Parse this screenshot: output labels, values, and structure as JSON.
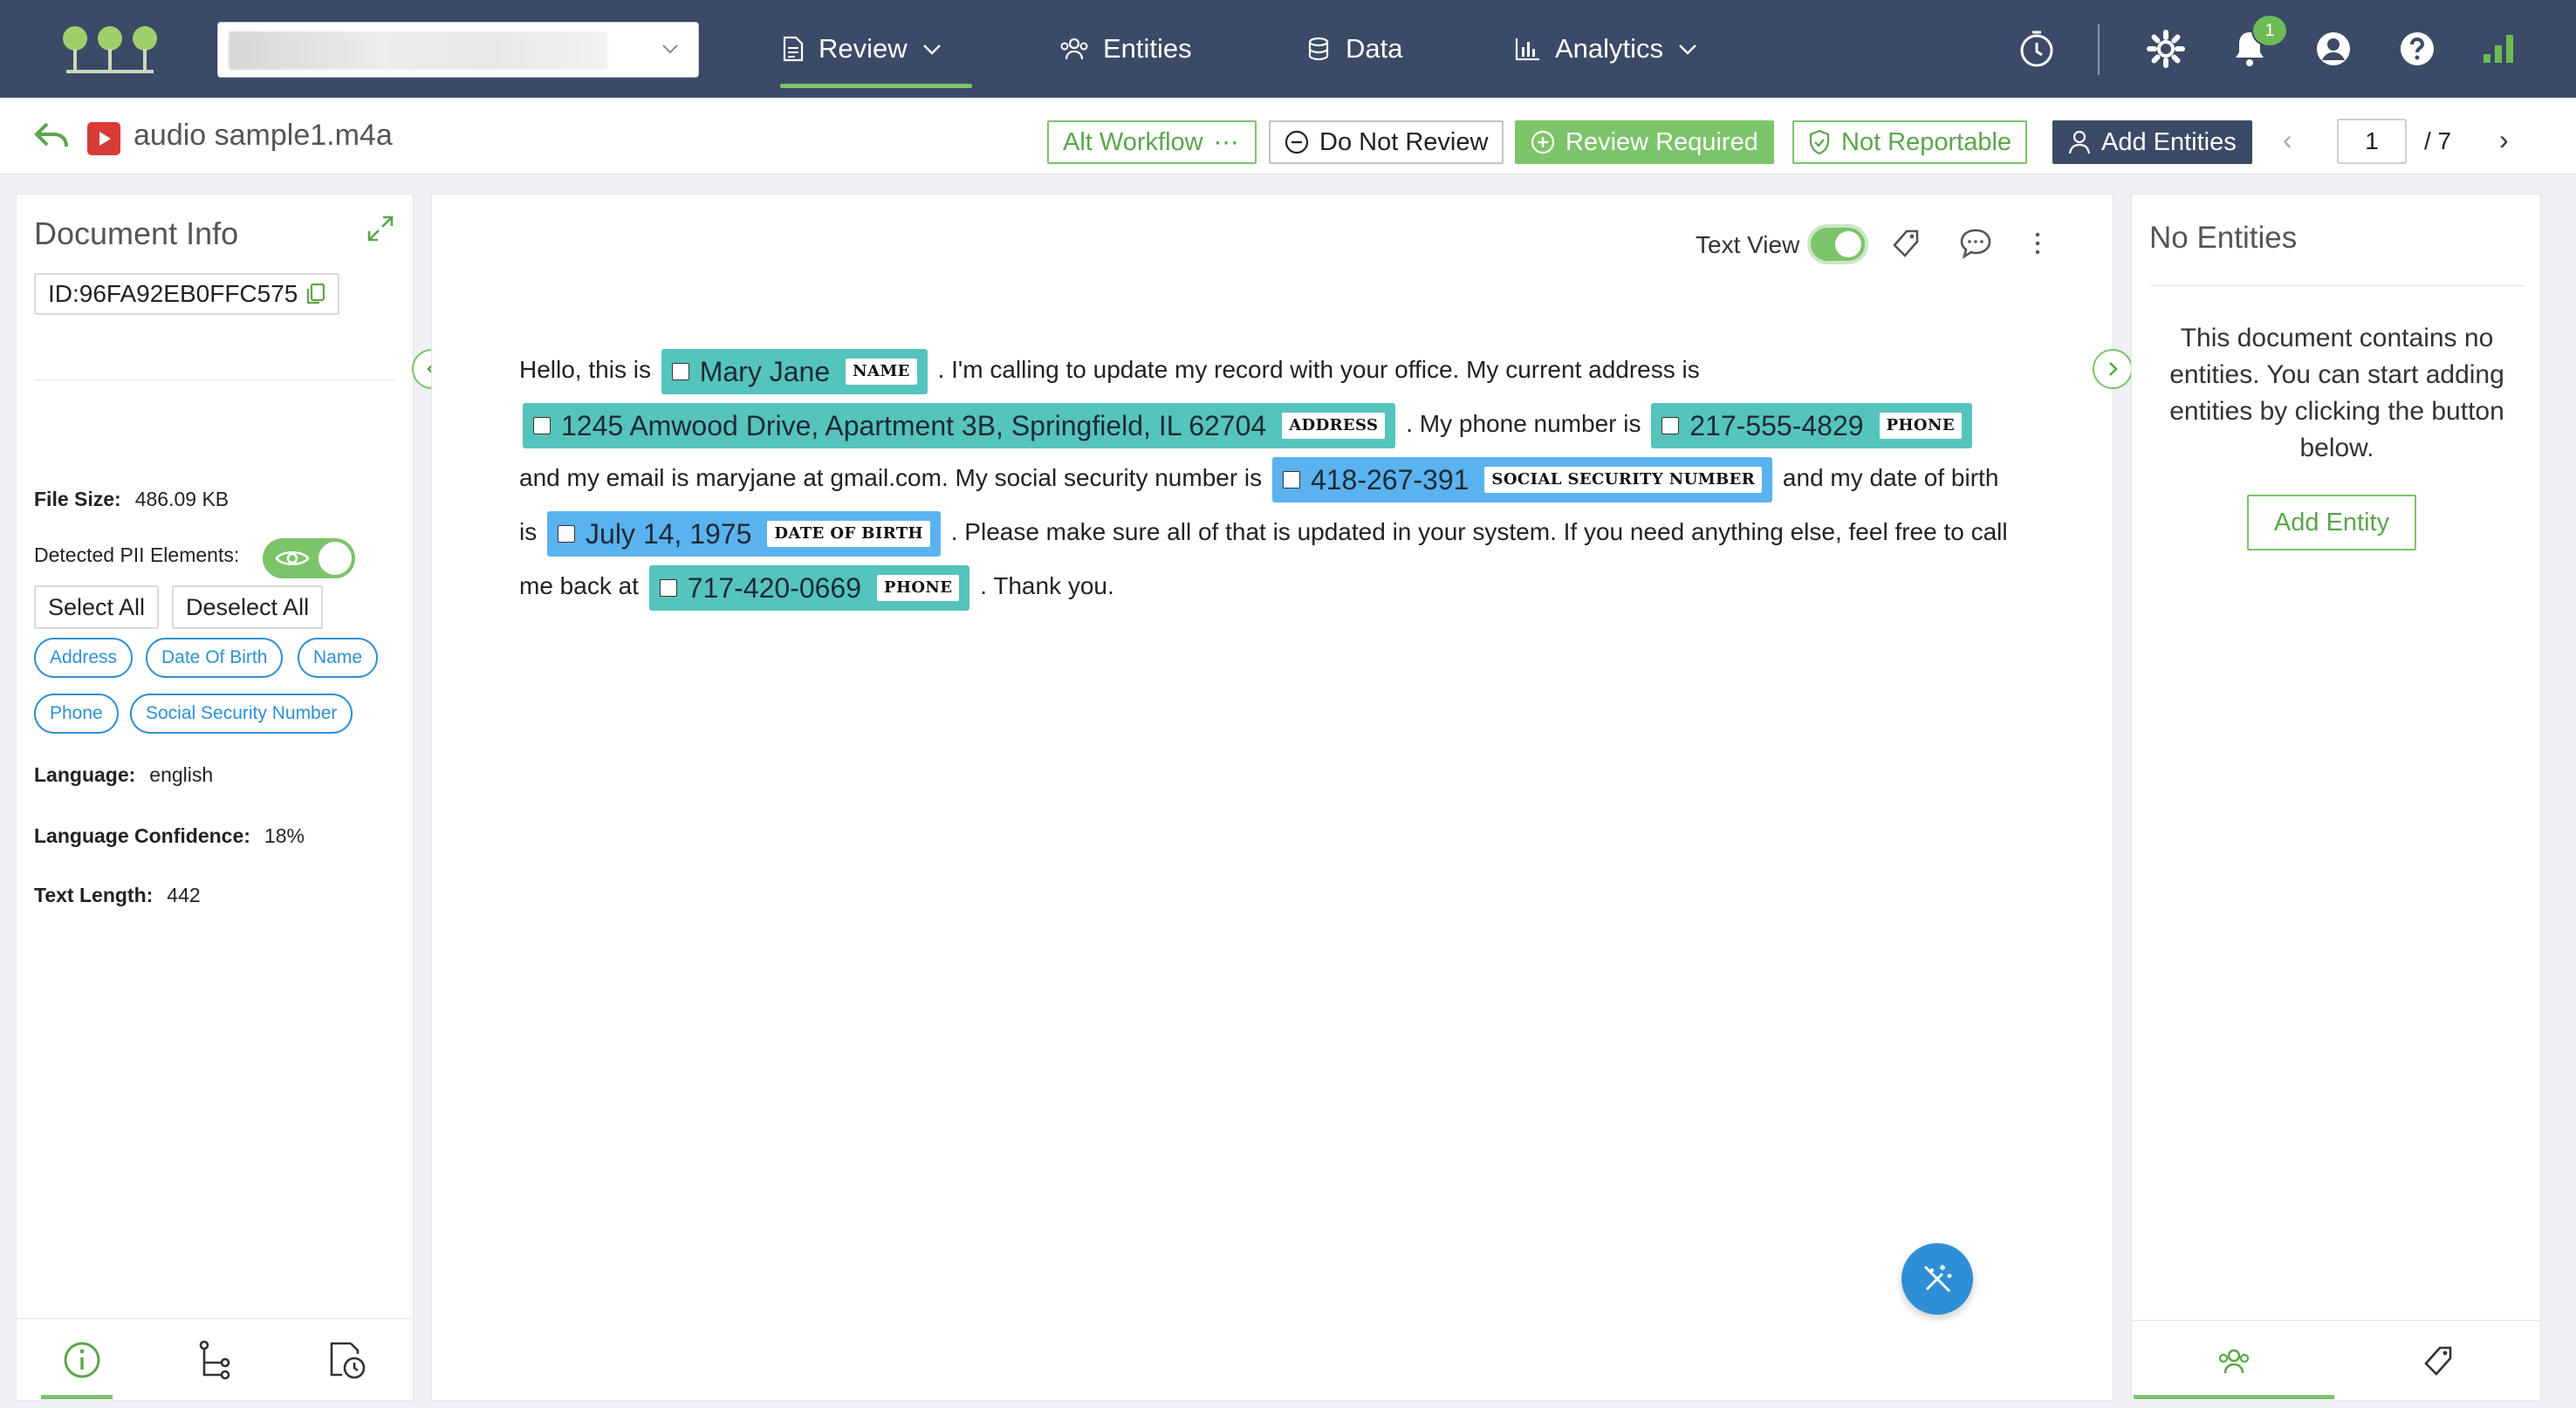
{
  "nav": {
    "review": "Review",
    "entities": "Entities",
    "data": "Data",
    "analytics": "Analytics"
  },
  "notifications": {
    "count": "1"
  },
  "file": {
    "name": "audio sample1.m4a"
  },
  "actions": {
    "alt_workflow": "Alt Workflow",
    "do_not_review": "Do Not Review",
    "review_required": "Review Required",
    "not_reportable": "Not Reportable",
    "add_entities": "Add Entities"
  },
  "pager": {
    "current": "1",
    "total": "/ 7"
  },
  "doc_info": {
    "title": "Document Info",
    "id": "ID:96FA92EB0FFC575",
    "file_size_label": "File Size:",
    "file_size": "486.09 KB",
    "pii_label": "Detected PII Elements:",
    "select_all": "Select All",
    "deselect_all": "Deselect All",
    "chips": [
      "Address",
      "Date Of Birth",
      "Name",
      "Phone",
      "Social Security Number"
    ],
    "language_label": "Language:",
    "language": "english",
    "confidence_label": "Language Confidence:",
    "confidence": "18%",
    "text_length_label": "Text Length:",
    "text_length": "442"
  },
  "text_view": {
    "label": "Text View"
  },
  "transcript": {
    "t1": "Hello, this is",
    "e1": "Mary Jane",
    "e1_tag": "NAME",
    "t2": ". I'm calling to update my record with your office. My current address is",
    "e2": "1245 Amwood Drive, Apartment 3B, Springfield, IL 62704",
    "e2_tag": "ADDRESS",
    "t3": ". My phone number is",
    "e3": "217-555-4829",
    "e3_tag": "PHONE",
    "t4": "and my email is maryjane at gmail.com. My social security number is",
    "e4": "418-267-391",
    "e4_tag": "SOCIAL SECURITY NUMBER",
    "t5": "and my date of birth is",
    "e5": "July 14, 1975",
    "e5_tag": "DATE OF BIRTH",
    "t6": ". Please make sure all of that is updated in your system. If you need anything else, feel free to call me back at",
    "e6": "717-420-0669",
    "e6_tag": "PHONE",
    "t7": ". Thank you."
  },
  "entities_panel": {
    "title": "No Entities",
    "message": "This document contains no entities. You can start adding entities by clicking the button below.",
    "add_button": "Add Entity"
  },
  "colors": {
    "topbar": "#3b4a66",
    "accent_green": "#7cc46a",
    "entity_teal": "#55c4bc",
    "entity_blue": "#5ab2ee",
    "chip_blue": "#2f8fd6"
  }
}
